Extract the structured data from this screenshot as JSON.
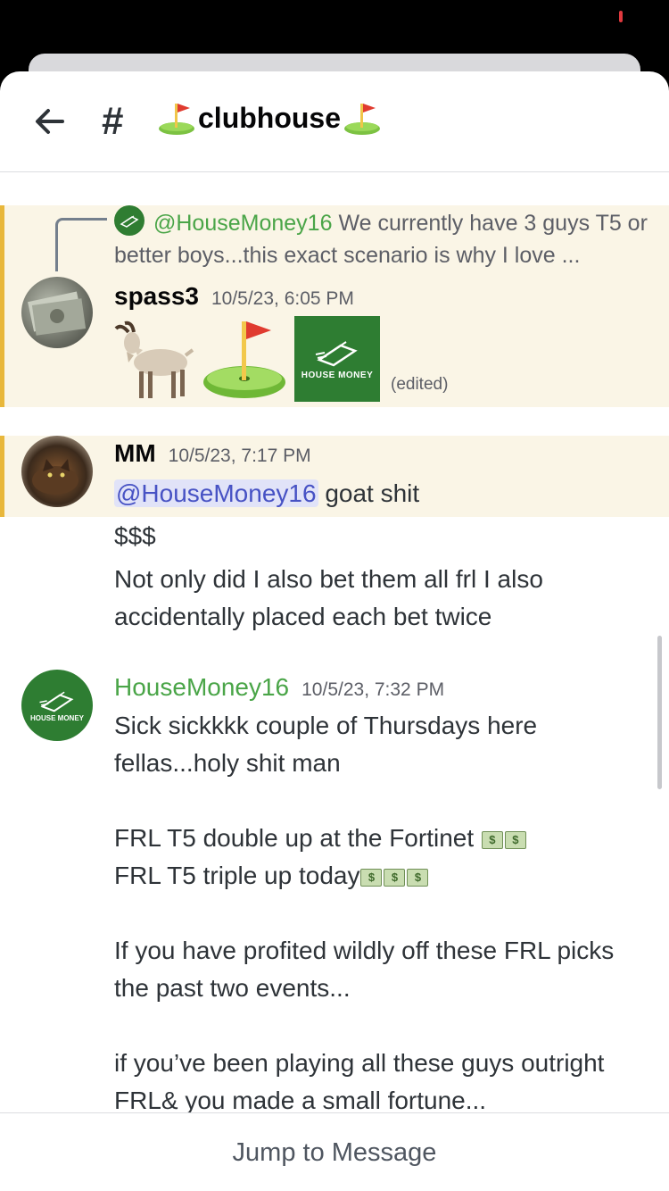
{
  "channel": {
    "hash": "#",
    "name": "clubhouse"
  },
  "messages": [
    {
      "reply": {
        "mention": "@HouseMoney16",
        "text": "We currently have 3 guys T5 or better boys...this exact scenario is why I love ..."
      },
      "author": "spass3",
      "timestamp": "10/5/23, 6:05 PM",
      "sticker_label": "HOUSE MONEY",
      "edited": "(edited)"
    },
    {
      "author": "MM",
      "timestamp": "10/5/23, 7:17 PM",
      "mention": "@HouseMoney16",
      "text_after_mention": " goat shit",
      "line2": "$$$",
      "line3": "Not only did I also bet them all frl I also accidentally placed each bet twice"
    },
    {
      "author": "HouseMoney16",
      "author_color": "#4aa548",
      "timestamp": "10/5/23, 7:32 PM",
      "avatar_label": "HOUSE MONEY",
      "p1": "Sick sickkkk couple of Thursdays here fellas...holy shit man",
      "p2a": "FRL T5 double up at the Fortinet ",
      "p2b": "FRL T5 triple up today",
      "p3": "If you have profited wildly off these FRL picks the past two events...",
      "p4": "if you’ve been playing all these guys outright FRL& you made a small fortune..."
    }
  ],
  "footer": {
    "jump_label": "Jump to Message"
  },
  "colors": {
    "accent_highlight": "#e8b73b",
    "mention_bg": "#e1e3f8",
    "mention_fg": "#4752c4"
  },
  "icons": [
    "back-arrow-icon",
    "golf-flag-icon",
    "goat-icon",
    "money-bag-icon"
  ]
}
